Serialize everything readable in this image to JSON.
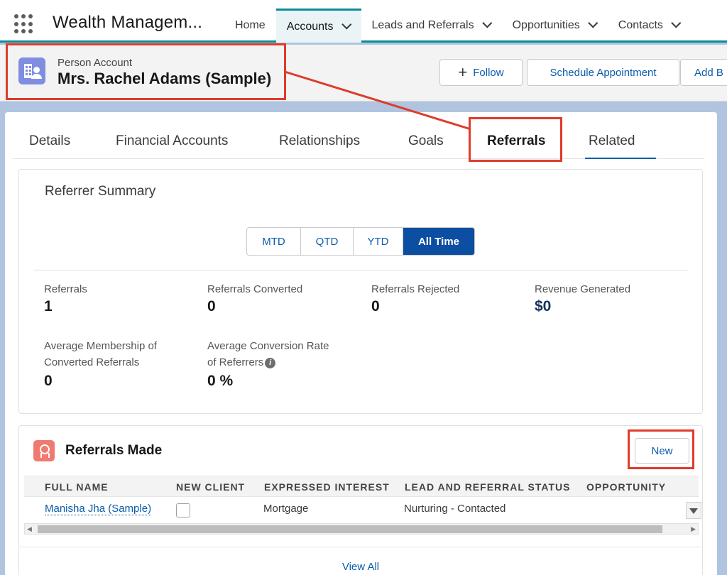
{
  "app": {
    "name": "Wealth Managem...",
    "launcher_icon": "app-launcher-icon"
  },
  "nav": {
    "items": [
      {
        "label": "Home",
        "active": false,
        "dropdown": false
      },
      {
        "label": "Accounts",
        "active": true,
        "dropdown": true
      },
      {
        "label": "Leads and Referrals",
        "active": false,
        "dropdown": true
      },
      {
        "label": "Opportunities",
        "active": false,
        "dropdown": true
      },
      {
        "label": "Contacts",
        "active": false,
        "dropdown": true
      }
    ]
  },
  "record": {
    "type": "Person Account",
    "name": "Mrs. Rachel Adams (Sample)",
    "icon": "person-account-icon",
    "actions": {
      "follow": "Follow",
      "schedule": "Schedule Appointment",
      "add": "Add B"
    }
  },
  "tabs": [
    {
      "label": "Details"
    },
    {
      "label": "Financial Accounts"
    },
    {
      "label": "Relationships"
    },
    {
      "label": "Goals"
    },
    {
      "label": "Referrals",
      "active": true
    },
    {
      "label": "Related"
    }
  ],
  "summary": {
    "title": "Referrer Summary",
    "periods": [
      "MTD",
      "QTD",
      "YTD",
      "All Time"
    ],
    "selected_period": "All Time",
    "stats": {
      "referrals": {
        "label": "Referrals",
        "value": "1"
      },
      "converted": {
        "label": "Referrals Converted",
        "value": "0"
      },
      "rejected": {
        "label": "Referrals Rejected",
        "value": "0"
      },
      "revenue": {
        "label": "Revenue Generated",
        "value": "$0"
      },
      "avg_membership": {
        "label_line1": "Average Membership of",
        "label_line2": "Converted Referrals",
        "value": "0"
      },
      "avg_conversion": {
        "label_line1": "Average Conversion Rate",
        "label_line2": "of Referrers",
        "value": "0 %"
      }
    }
  },
  "referrals_made": {
    "title": "Referrals Made",
    "new_label": "New",
    "columns": [
      "FULL NAME",
      "NEW CLIENT",
      "EXPRESSED INTEREST",
      "LEAD AND REFERRAL STATUS",
      "OPPORTUNITY"
    ],
    "rows": [
      {
        "full_name": "Manisha Jha (Sample)",
        "new_client": false,
        "expressed_interest": "Mortgage",
        "status": "Nurturing - Contacted",
        "opportunity": ""
      }
    ],
    "view_all": "View All"
  },
  "colors": {
    "accent": "#0b5cab",
    "nav_accent": "#0b8a9a",
    "highlight": "#e03b2a",
    "selected_segment": "#0b4ea2"
  }
}
